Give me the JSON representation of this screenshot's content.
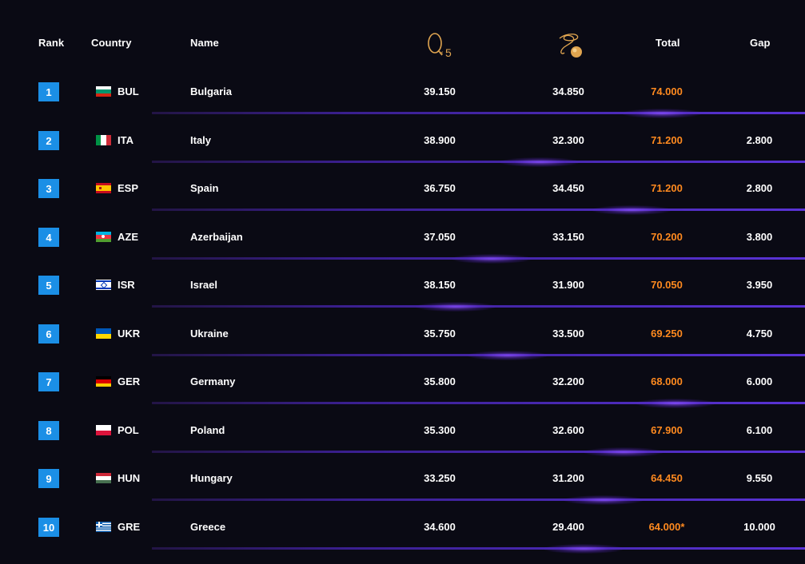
{
  "header": {
    "rank": "Rank",
    "country": "Country",
    "name": "Name",
    "hoop_icon": "hoop-x5-icon",
    "hoop_multiplier": "5",
    "ball_icon": "ribbon-ball-icon",
    "total": "Total",
    "gap": "Gap"
  },
  "colors": {
    "background": "#0a0a14",
    "rank_badge": "#1b8fe6",
    "total": "#ff8a1f",
    "separator": "#4b2ab8",
    "icon_gold": "#e0a550"
  },
  "rows": [
    {
      "rank": "1",
      "code": "BUL",
      "name": "Bulgaria",
      "hoop": "39.150",
      "ball": "34.850",
      "total": "74.000",
      "gap": ""
    },
    {
      "rank": "2",
      "code": "ITA",
      "name": "Italy",
      "hoop": "38.900",
      "ball": "32.300",
      "total": "71.200",
      "gap": "2.800"
    },
    {
      "rank": "3",
      "code": "ESP",
      "name": "Spain",
      "hoop": "36.750",
      "ball": "34.450",
      "total": "71.200",
      "gap": "2.800"
    },
    {
      "rank": "4",
      "code": "AZE",
      "name": "Azerbaijan",
      "hoop": "37.050",
      "ball": "33.150",
      "total": "70.200",
      "gap": "3.800"
    },
    {
      "rank": "5",
      "code": "ISR",
      "name": "Israel",
      "hoop": "38.150",
      "ball": "31.900",
      "total": "70.050",
      "gap": "3.950"
    },
    {
      "rank": "6",
      "code": "UKR",
      "name": "Ukraine",
      "hoop": "35.750",
      "ball": "33.500",
      "total": "69.250",
      "gap": "4.750"
    },
    {
      "rank": "7",
      "code": "GER",
      "name": "Germany",
      "hoop": "35.800",
      "ball": "32.200",
      "total": "68.000",
      "gap": "6.000"
    },
    {
      "rank": "8",
      "code": "POL",
      "name": "Poland",
      "hoop": "35.300",
      "ball": "32.600",
      "total": "67.900",
      "gap": "6.100"
    },
    {
      "rank": "9",
      "code": "HUN",
      "name": "Hungary",
      "hoop": "33.250",
      "ball": "31.200",
      "total": "64.450",
      "gap": "9.550"
    },
    {
      "rank": "10",
      "code": "GRE",
      "name": "Greece",
      "hoop": "34.600",
      "ball": "29.400",
      "total": "64.000*",
      "gap": "10.000"
    }
  ]
}
